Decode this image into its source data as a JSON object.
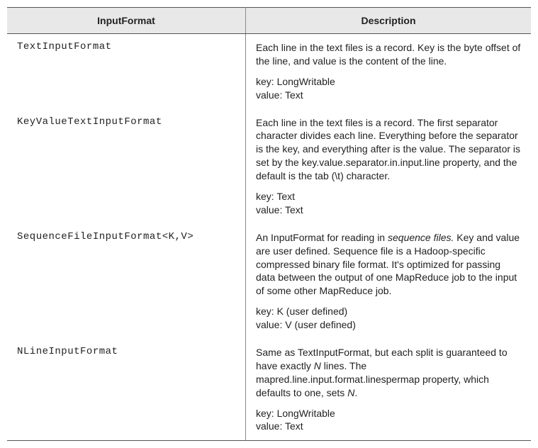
{
  "headers": {
    "col1": "InputFormat",
    "col2": "Description"
  },
  "rows": [
    {
      "format": "TextInputFormat",
      "desc": "Each line in the text files is a record. Key is the byte offset of the line, and value is the content of the line.",
      "key": "key: LongWritable",
      "value": "value: Text"
    },
    {
      "format": "KeyValueTextInputFormat",
      "desc": "Each line in the text files is a record. The first separator character divides each line. Everything before the separator is the key, and everything after is the value. The separator is set by the key.value.separator.in.input.line property, and the default is the tab (\\t) character.",
      "key": "key: Text",
      "value": "value: Text"
    },
    {
      "format": "SequenceFileInputFormat<K,V>",
      "desc_pre": "An InputFormat for reading in ",
      "desc_em": "sequence files.",
      "desc_post": " Key and value are user defined. Sequence file is a Hadoop-specific compressed binary file format. It's optimized for passing data between the output of one MapReduce job to the input of some other MapReduce job.",
      "key": "key: K (user defined)",
      "value": "value: V (user defined)"
    },
    {
      "format": "NLineInputFormat",
      "desc_pre": "Same as TextInputFormat, but each split is guaranteed to have exactly ",
      "desc_em": "N",
      "desc_mid": " lines. The mapred.line.input.format.linespermap property, which defaults to one, sets ",
      "desc_em2": "N",
      "desc_post": ".",
      "key": "key: LongWritable",
      "value": "value: Text"
    }
  ]
}
